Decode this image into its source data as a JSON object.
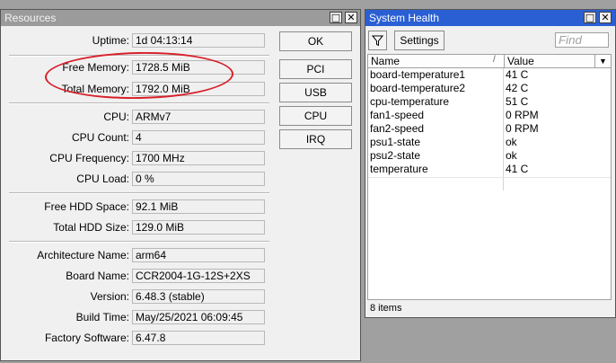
{
  "resources": {
    "title": "Resources",
    "title_buttons": [
      "□",
      "✕"
    ],
    "rows": [
      {
        "label": "Uptime:",
        "value": "1d 04:13:14"
      },
      {
        "label": "Free Memory:",
        "value": "1728.5 MiB"
      },
      {
        "label": "Total Memory:",
        "value": "1792.0 MiB"
      },
      {
        "label": "CPU:",
        "value": "ARMv7"
      },
      {
        "label": "CPU Count:",
        "value": "4"
      },
      {
        "label": "CPU Frequency:",
        "value": "1700 MHz"
      },
      {
        "label": "CPU Load:",
        "value": "0 %"
      },
      {
        "label": "Free HDD Space:",
        "value": "92.1 MiB"
      },
      {
        "label": "Total HDD Size:",
        "value": "129.0 MiB"
      },
      {
        "label": "Architecture Name:",
        "value": "arm64"
      },
      {
        "label": "Board Name:",
        "value": "CCR2004-1G-12S+2XS"
      },
      {
        "label": "Version:",
        "value": "6.48.3 (stable)"
      },
      {
        "label": "Build Time:",
        "value": "May/25/2021 06:09:45"
      },
      {
        "label": "Factory Software:",
        "value": "6.47.8"
      }
    ],
    "buttons": {
      "ok": "OK",
      "pci": "PCI",
      "usb": "USB",
      "cpu": "CPU",
      "irq": "IRQ"
    }
  },
  "health": {
    "title": "System Health",
    "title_buttons": [
      "□",
      "✕"
    ],
    "settings_label": "Settings",
    "filter_icon": "funnel-icon",
    "find_placeholder": "Find",
    "columns": {
      "name": "Name",
      "value": "Value",
      "sort_glyph": "/",
      "menu_glyph": "▼"
    },
    "rows": [
      {
        "name": "board-temperature1",
        "value": "41 C"
      },
      {
        "name": "board-temperature2",
        "value": "42 C"
      },
      {
        "name": "cpu-temperature",
        "value": "51 C"
      },
      {
        "name": "fan1-speed",
        "value": "0 RPM"
      },
      {
        "name": "fan2-speed",
        "value": "0 RPM"
      },
      {
        "name": "psu1-state",
        "value": "ok"
      },
      {
        "name": "psu2-state",
        "value": "ok"
      },
      {
        "name": "temperature",
        "value": "41 C"
      }
    ],
    "status_text": "8 items"
  },
  "colors": {
    "annotation": "#d8202a",
    "active_title": "#2a5fd4",
    "inactive_title": "#9b9b9b"
  }
}
